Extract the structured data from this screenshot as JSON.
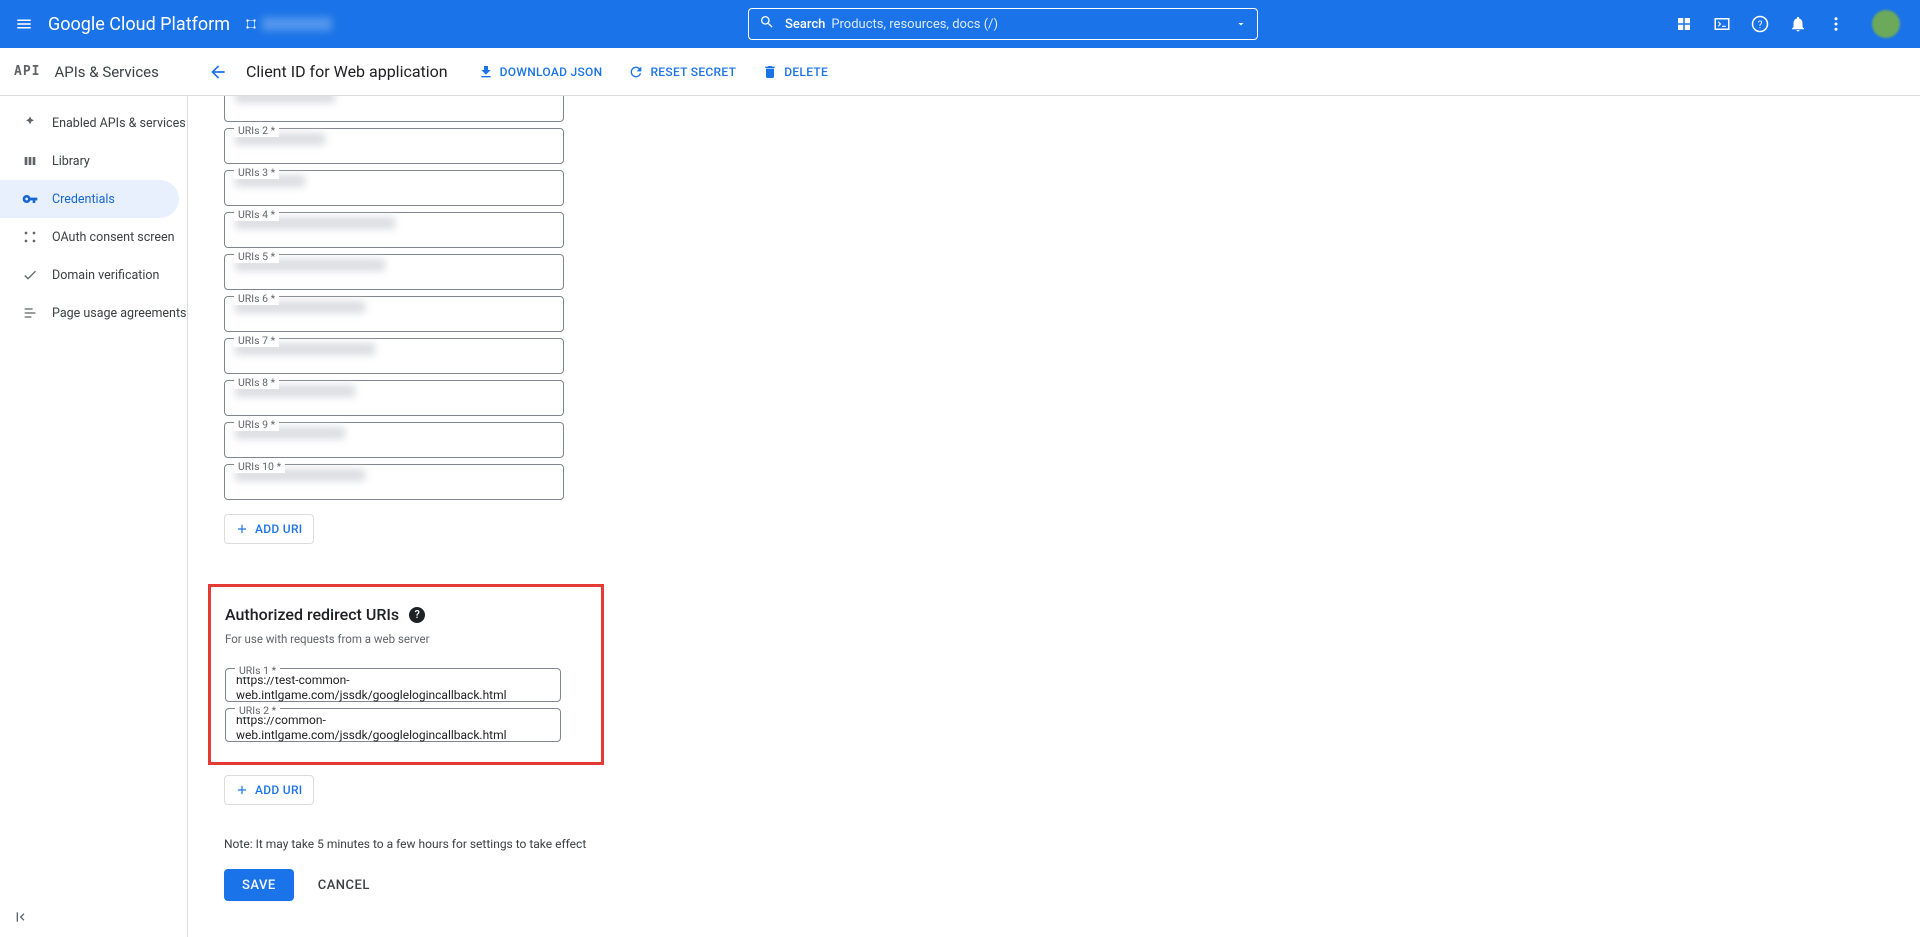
{
  "header": {
    "product_name": "Google Cloud Platform",
    "search_label": "Search",
    "search_placeholder": "Products, resources, docs (/)"
  },
  "subheader": {
    "api_label": "API",
    "section_title": "APIs & Services",
    "page_title": "Client ID for Web application",
    "download_label": "DOWNLOAD JSON",
    "reset_label": "RESET SECRET",
    "delete_label": "DELETE"
  },
  "sidebar": {
    "items": [
      {
        "label": "Enabled APIs & services"
      },
      {
        "label": "Library"
      },
      {
        "label": "Credentials"
      },
      {
        "label": "OAuth consent screen"
      },
      {
        "label": "Domain verification"
      },
      {
        "label": "Page usage agreements"
      }
    ]
  },
  "origins": {
    "labels": [
      "URIs 2 *",
      "URIs 3 *",
      "URIs 4 *",
      "URIs 5 *",
      "URIs 6 *",
      "URIs 7 *",
      "URIs 8 *",
      "URIs 9 *",
      "URIs 10 *"
    ],
    "add_label": "ADD URI"
  },
  "redirect": {
    "title": "Authorized redirect URIs",
    "desc": "For use with requests from a web server",
    "fields": [
      {
        "label": "URIs 1 *",
        "value": "https://test-common-web.intlgame.com/jssdk/googlelogincallback.html"
      },
      {
        "label": "URIs 2 *",
        "value": "https://common-web.intlgame.com/jssdk/googlelogincallback.html"
      }
    ],
    "add_label": "ADD URI"
  },
  "footer": {
    "note": "Note: It may take 5 minutes to a few hours for settings to take effect",
    "save": "SAVE",
    "cancel": "CANCEL"
  }
}
